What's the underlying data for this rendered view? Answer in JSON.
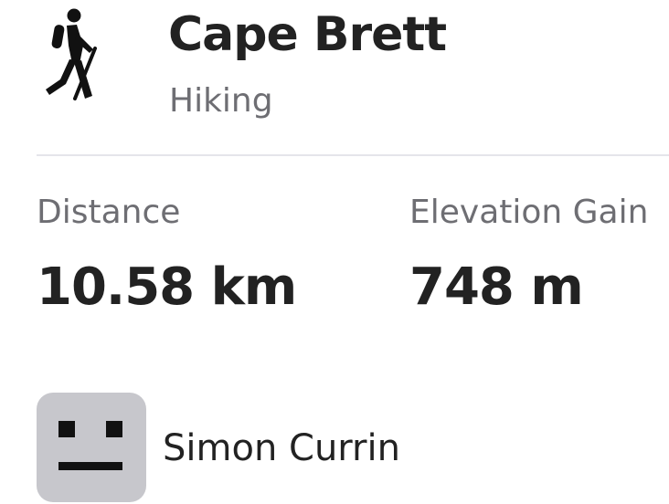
{
  "activity": {
    "icon": "hiker-icon",
    "title": "Cape Brett",
    "type": "Hiking"
  },
  "stats": {
    "distance": {
      "label": "Distance",
      "value": "10.58 km"
    },
    "elevation_gain": {
      "label": "Elevation Gain",
      "value": "748 m"
    }
  },
  "user": {
    "avatar_icon": "default-avatar-icon",
    "name": "Simon Currin"
  },
  "colors": {
    "primary_text": "#222222",
    "secondary_text": "#6e6e73",
    "divider": "#e5e5ea",
    "avatar_background": "#c7c7cc"
  }
}
